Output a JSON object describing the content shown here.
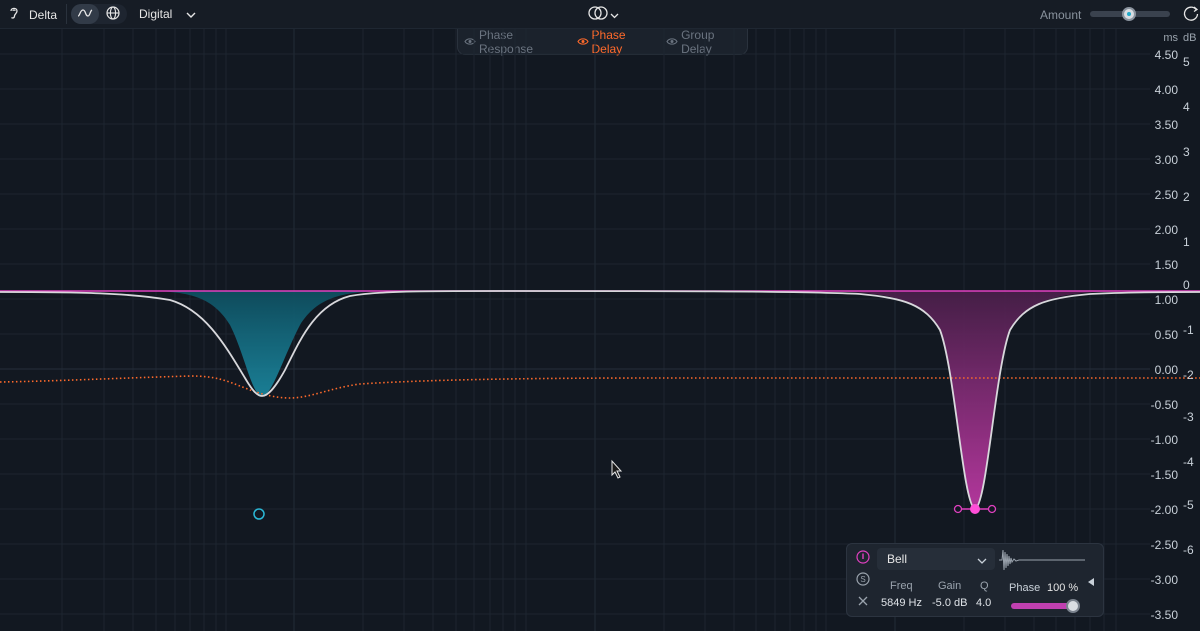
{
  "toolbar": {
    "delta_label": "Delta",
    "mode_label": "Digital",
    "amount_label": "Amount",
    "amount_value": 0.5,
    "icons": [
      "ear-icon",
      "wave-icon",
      "globe-icon",
      "chevron-down-icon",
      "stereo-link-icon",
      "loop-icon"
    ]
  },
  "view_tabs": [
    {
      "label": "Phase Response",
      "active": false
    },
    {
      "label": "Phase Delay",
      "active": true
    },
    {
      "label": "Group Delay",
      "active": false
    }
  ],
  "axis": {
    "ms_unit": "ms",
    "db_unit": "dB",
    "ms_ticks": [
      "4.50",
      "4.00",
      "3.50",
      "3.00",
      "2.50",
      "2.00",
      "1.50",
      "1.00",
      "0.50",
      "0.00",
      "-0.50",
      "-1.00",
      "-1.50",
      "-2.00",
      "-2.50",
      "-3.00",
      "-3.50"
    ],
    "db_ticks": [
      "5",
      "4",
      "3",
      "2",
      "1",
      "0",
      "-1",
      "-2",
      "-3",
      "-4",
      "-5",
      "-6"
    ]
  },
  "band_panel": {
    "type": "Bell",
    "freq_label": "Freq",
    "freq_value": "5849 Hz",
    "gain_label": "Gain",
    "gain_value": "-5.0 dB",
    "q_label": "Q",
    "q_value": "4.0",
    "phase_label": "Phase",
    "phase_value": "100 %",
    "phase_amount": 1.0,
    "side_buttons": [
      "power-icon",
      "solo-icon",
      "close-icon"
    ]
  },
  "colors": {
    "background": "#121821",
    "band1": "#2bb8d6",
    "band2": "#e040c0",
    "phase_delay": "#ff6a2b",
    "response": "#d8d8dc",
    "accent": "#ff6a2b"
  }
}
